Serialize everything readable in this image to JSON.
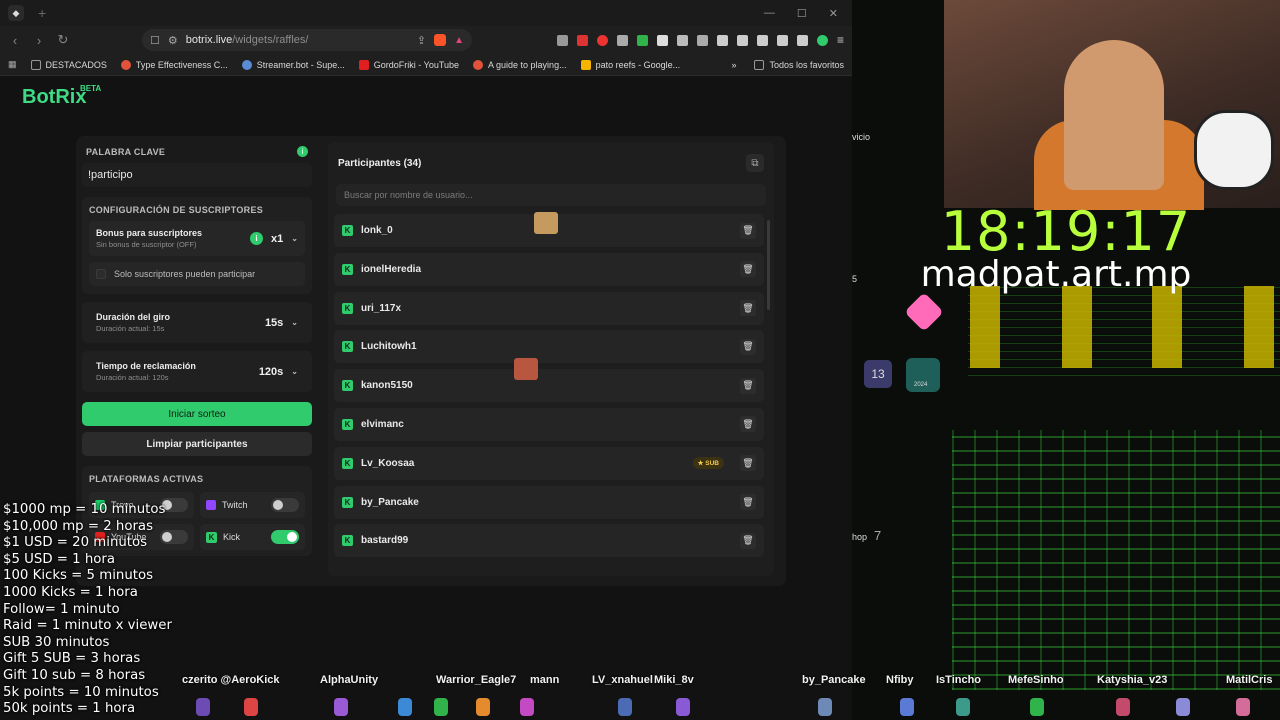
{
  "browser": {
    "url_host": "botrix.live",
    "url_path": "/widgets/raffles/",
    "bookmarks": [
      {
        "label": "DESTACADOS",
        "color": "#888888"
      },
      {
        "label": "Type Effectiveness C...",
        "color": "#e0533a"
      },
      {
        "label": "Streamer.bot - Supe...",
        "color": "#5a8cd6"
      },
      {
        "label": "GordoFriki - YouTube",
        "color": "#e02020"
      },
      {
        "label": "A guide to playing...",
        "color": "#e0533a"
      },
      {
        "label": "pato reefs - Google...",
        "color": "#f4b400"
      }
    ],
    "bookmarks_more": "»",
    "bookmarks_all": "Todos los favoritos"
  },
  "app": {
    "logo": "BotRix",
    "beta": "BETA"
  },
  "keyword": {
    "label": "PALABRA CLAVE",
    "value": "!participo"
  },
  "subscriber_config": {
    "label": "CONFIGURACIÓN DE SUSCRIPTORES",
    "bonus_title": "Bonus para suscriptores",
    "bonus_sub": "Sin bonus de suscriptor (OFF)",
    "bonus_value": "x1",
    "only_subs": "Solo suscriptores pueden participar"
  },
  "spin": {
    "title": "Duración del giro",
    "sub": "Duración actual: 15s",
    "value": "15s"
  },
  "claim": {
    "title": "Tiempo de reclamación",
    "sub": "Duración actual: 120s",
    "value": "120s"
  },
  "buttons": {
    "start": "Iniciar sorteo",
    "clear": "Limpiar participantes"
  },
  "platforms": {
    "label": "PLATAFORMAS ACTIVAS",
    "items": [
      {
        "name": "Trovo",
        "on": false
      },
      {
        "name": "Twitch",
        "on": false
      },
      {
        "name": "YouTube",
        "on": false
      },
      {
        "name": "Kick",
        "on": true
      }
    ]
  },
  "participants": {
    "title": "Participantes (34)",
    "search_placeholder": "Buscar por nombre de usuario...",
    "rows": [
      {
        "name": "lonk_0",
        "sub": false
      },
      {
        "name": "ionelHeredia",
        "sub": false
      },
      {
        "name": "uri_117x",
        "sub": false
      },
      {
        "name": "Luchitowh1",
        "sub": false
      },
      {
        "name": "kanon5150",
        "sub": false
      },
      {
        "name": "elvimanc",
        "sub": false
      },
      {
        "name": "Lv_Koosaa",
        "sub": true
      },
      {
        "name": "by_Pancake",
        "sub": false
      },
      {
        "name": "bastard99",
        "sub": false
      }
    ],
    "sub_label": "★ SUB"
  },
  "stream": {
    "clock": "18:19:17",
    "handle": "madpat.art.mp",
    "badge_13": "13",
    "badge_2024": "2024",
    "side_text_1": "vicio",
    "side_text_2": "hop",
    "side_num": "7",
    "side_num_2": "5"
  },
  "rates": [
    "$1000 mp = 10 minutos",
    "$10,000 mp = 2 horas",
    "$1 USD = 20 minutos",
    "$5 USD = 1 hora",
    "100 Kicks = 5 minutos",
    "1000 Kicks = 1 hora",
    "Follow= 1 minuto",
    "Raid = 1 minuto x viewer",
    "SUB 30 minutos",
    "Gift 5 SUB = 3 horas",
    "Gift 10 sub = 8 horas",
    "5k points = 10 minutos",
    "50k points = 1 hora"
  ],
  "ticker": [
    "czerito @AeroKick",
    "AlphaUnity",
    "Warrior_Eagle7",
    "mann",
    "LV_xnahuel",
    "Miki_8v",
    "by_Pancake",
    "Nfiby",
    "IsTincho",
    "MefeSinho",
    "Katyshia_v23",
    "MatilCris"
  ]
}
